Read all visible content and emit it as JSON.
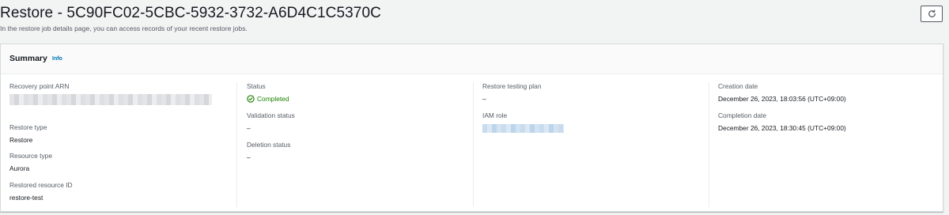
{
  "header": {
    "title": "Restore - 5C90FC02-5CBC-5932-3732-A6D4C1C5370C",
    "description": "In the restore job details page, you can access records of your recent restore jobs.",
    "refresh_icon": "refresh-icon"
  },
  "summary": {
    "title": "Summary",
    "info_label": "Info",
    "columns": [
      {
        "fields": [
          {
            "label": "Recovery point ARN",
            "value": "",
            "redacted": true
          },
          {
            "label": "Restore type",
            "value": "Restore"
          },
          {
            "label": "Resource type",
            "value": "Aurora"
          },
          {
            "label": "Restored resource ID",
            "value": "restore-test"
          }
        ]
      },
      {
        "fields": [
          {
            "label": "Status",
            "value": "Completed",
            "status_color": "#1d8102",
            "icon": "check-circle-icon"
          },
          {
            "label": "Validation status",
            "value": "–"
          },
          {
            "label": "Deletion status",
            "value": "–"
          }
        ]
      },
      {
        "fields": [
          {
            "label": "Restore testing plan",
            "value": "–"
          },
          {
            "label": "IAM role",
            "value": "",
            "redacted": true
          }
        ]
      },
      {
        "fields": [
          {
            "label": "Creation date",
            "value": "December 26, 2023, 18:03:56 (UTC+09:00)"
          },
          {
            "label": "Completion date",
            "value": "December 26, 2023, 18:30:45 (UTC+09:00)"
          }
        ]
      }
    ]
  },
  "colors": {
    "background": "#f2f3f3",
    "link": "#0073bb",
    "success": "#1d8102",
    "text": "#16191f",
    "secondary_text": "#545b64"
  }
}
